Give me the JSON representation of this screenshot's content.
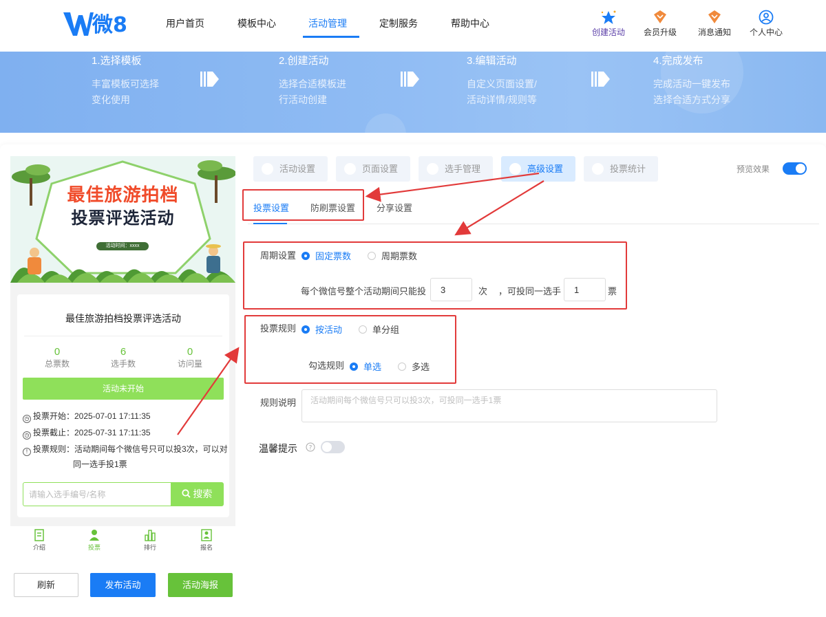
{
  "header": {
    "logo_text": "微8",
    "nav": [
      "用户首页",
      "模板中心",
      "活动管理",
      "定制服务",
      "帮助中心"
    ],
    "active_nav": "活动管理",
    "actions": [
      {
        "label": "创建活动",
        "icon": "star-icon"
      },
      {
        "label": "会员升级",
        "icon": "vip-badge-icon"
      },
      {
        "label": "消息通知",
        "icon": "message-badge-icon"
      },
      {
        "label": "个人中心",
        "icon": "user-circle-icon"
      }
    ]
  },
  "banner": {
    "steps": [
      {
        "title": "1.选择模板",
        "desc1": "丰富模板可选择",
        "desc2": "变化使用"
      },
      {
        "title": "2.创建活动",
        "desc1": "选择合适模板进",
        "desc2": "行活动创建"
      },
      {
        "title": "3.编辑活动",
        "desc1": "自定义页面设置/",
        "desc2": "活动详情/规则等"
      },
      {
        "title": "4.完成发布",
        "desc1": "完成活动一键发布",
        "desc2": "选择合适方式分享"
      }
    ]
  },
  "preview": {
    "poster_title_1": "最佳旅游拍档",
    "poster_title_2": "投票评选活动",
    "poster_time": "活动时间：xxxx",
    "activity_title": "最佳旅游拍档投票评选活动",
    "stats": [
      {
        "value": "0",
        "label": "总票数"
      },
      {
        "value": "6",
        "label": "选手数"
      },
      {
        "value": "0",
        "label": "访问量"
      }
    ],
    "status": "活动未开始",
    "vote_start": "投票开始：2025-07-01 17:11:35",
    "vote_end": "投票截止：2025-07-31 17:11:35",
    "vote_rule_1": "投票规则：活动期间每个微信号只可以投3次，可以对",
    "vote_rule_2": "同一选手投1票",
    "search_placeholder": "请输入选手编号/名称",
    "search_button": "搜索",
    "tabbar": [
      "介绍",
      "投票",
      "排行",
      "报名"
    ],
    "tabbar_active": "投票"
  },
  "buttons": {
    "refresh": "刷新",
    "publish": "发布活动",
    "poster": "活动海报"
  },
  "settings": {
    "top_tabs": [
      "活动设置",
      "页面设置",
      "选手管理",
      "高级设置",
      "投票统计"
    ],
    "active_top_tab": "高级设置",
    "preview_label": "预览效果",
    "preview_on": true,
    "sub_tabs": [
      "投票设置",
      "防刷票设置",
      "分享设置"
    ],
    "active_sub_tab": "投票设置",
    "cycle_label": "周期设置",
    "cycle_options": [
      "固定票数",
      "周期票数"
    ],
    "cycle_selected": "固定票数",
    "limit_text_1": "每个微信号整个活动期间只能投",
    "limit_votes": "3",
    "limit_text_2": "次",
    "limit_text_3": "，可投同一选手",
    "same_player_votes": "1",
    "limit_text_4": "票",
    "rule_label": "投票规则",
    "rule_options": [
      "按活动",
      "单分组"
    ],
    "rule_selected": "按活动",
    "check_label": "勾选规则",
    "check_options": [
      "单选",
      "多选"
    ],
    "check_selected": "单选",
    "desc_label": "规则说明",
    "desc_placeholder": "活动期间每个微信号只可以投3次，可投同一选手1票",
    "tip_label": "温馨提示",
    "tip_on": false
  },
  "colors": {
    "primary": "#1a7cf5",
    "green": "#67c23a",
    "annotation_red": "#e23a3a"
  }
}
